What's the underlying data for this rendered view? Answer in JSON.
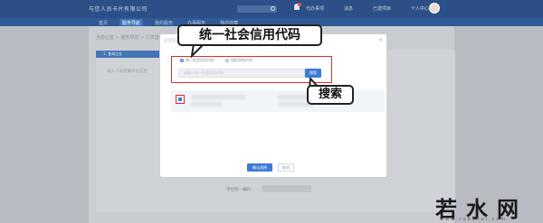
{
  "header": {
    "app_title": "与您人员卡片有限公司",
    "links": [
      "代办事项",
      "消息",
      "已建项目",
      "个人中心"
    ]
  },
  "nav": {
    "tabs": [
      "首页",
      "服务导航",
      "我的服务",
      "办事服务",
      "我的收藏"
    ]
  },
  "breadcrumb": "当前位置 > 服务导航 > 人员登记",
  "step_label": "1. 查询企业",
  "panel_label": "录入人员所属单位信息",
  "bottom_label": "单位统一编码",
  "modal": {
    "title": "企业信息",
    "close": "×",
    "radio_options": [
      "统一社会信用代码",
      "组织机构代码"
    ],
    "input_placeholder": "请输入统一社会信用代码",
    "search_button": "搜索",
    "confirm_button": "确认选择",
    "cancel_button": "取消"
  },
  "annotations": {
    "callout_top": "统一社会信用代码",
    "callout_search": "搜索"
  },
  "watermark": {
    "text": "若水网",
    "sub": "www.ruoshui.com"
  },
  "colors": {
    "header_bg": "#2b4f86",
    "primary": "#3e7bd6",
    "highlight_red": "#e02a2a"
  }
}
